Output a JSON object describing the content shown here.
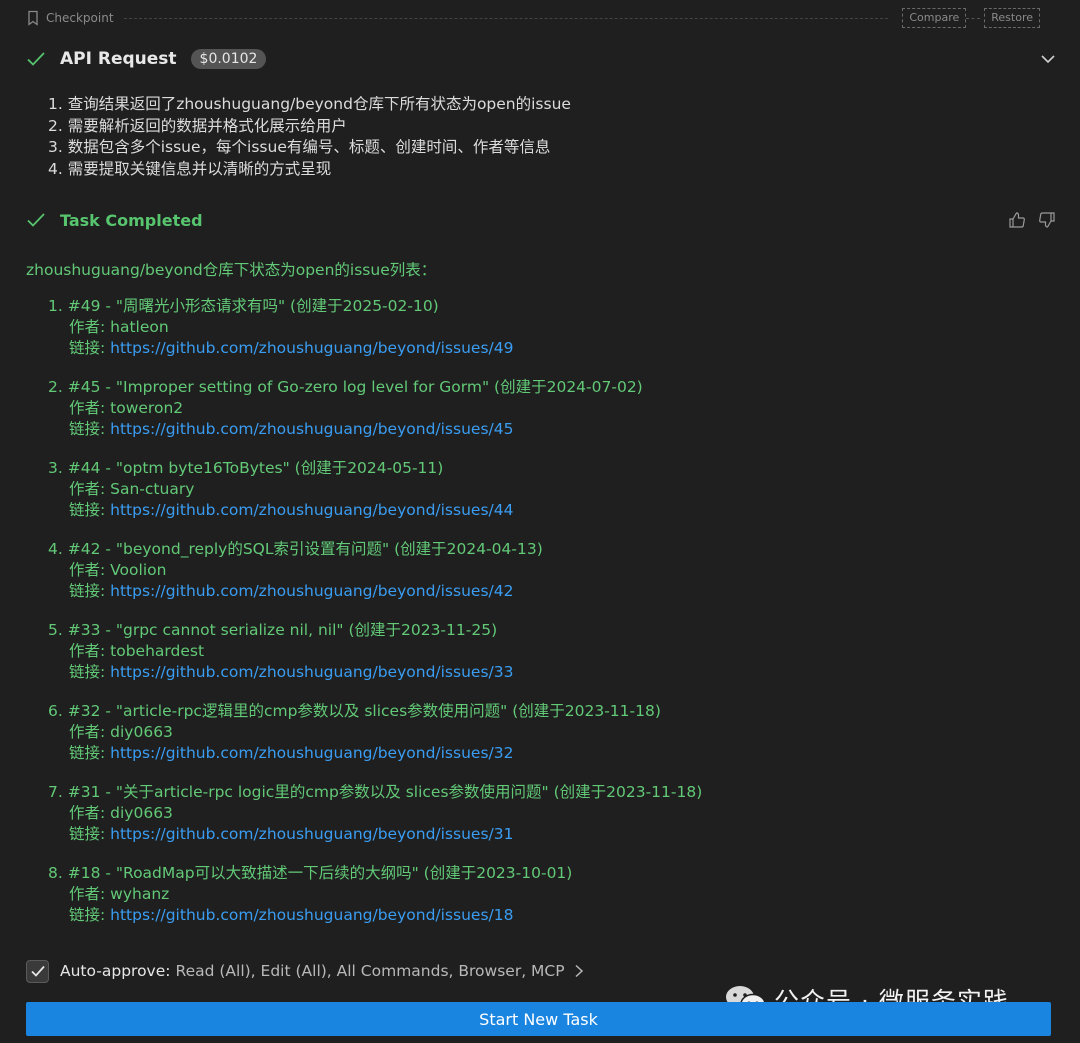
{
  "checkpoint": {
    "label": "Checkpoint",
    "compare": "Compare",
    "restore": "Restore"
  },
  "api_request": {
    "title": "API Request",
    "cost": "$0.0102",
    "items": [
      "1. 查询结果返回了zhoushuguang/beyond仓库下所有状态为open的issue",
      "2. 需要解析返回的数据并格式化展示给用户",
      "3. 数据包含多个issue，每个issue有编号、标题、创建时间、作者等信息",
      "4. 需要提取关键信息并以清晰的方式呈现"
    ]
  },
  "task": {
    "title": "Task Completed",
    "intro": "zhoushuguang/beyond仓库下状态为open的issue列表：",
    "issues": [
      {
        "header": "1. #49 - \"周曙光小形态请求有吗\" (创建于2025-02-10)",
        "author": "作者: hatleon",
        "link_label": "链接: ",
        "link": "https://github.com/zhoushuguang/beyond/issues/49"
      },
      {
        "header": "2. #45 - \"Improper setting of Go-zero log level for Gorm\" (创建于2024-07-02)",
        "author": "作者: toweron2",
        "link_label": "链接: ",
        "link": "https://github.com/zhoushuguang/beyond/issues/45"
      },
      {
        "header": "3. #44 - \"optm byte16ToBytes\" (创建于2024-05-11)",
        "author": "作者: San-ctuary",
        "link_label": "链接: ",
        "link": "https://github.com/zhoushuguang/beyond/issues/44"
      },
      {
        "header": "4. #42 - \"beyond_reply的SQL索引设置有问题\" (创建于2024-04-13)",
        "author": "作者: Voolion",
        "link_label": "链接: ",
        "link": "https://github.com/zhoushuguang/beyond/issues/42"
      },
      {
        "header": "5. #33 - \"grpc cannot serialize nil, nil\" (创建于2023-11-25)",
        "author": "作者: tobehardest",
        "link_label": "链接: ",
        "link": "https://github.com/zhoushuguang/beyond/issues/33"
      },
      {
        "header": "6. #32 - \"article-rpc逻辑里的cmp参数以及 slices参数使用问题\" (创建于2023-11-18)",
        "author": "作者: diy0663",
        "link_label": "链接: ",
        "link": "https://github.com/zhoushuguang/beyond/issues/32"
      },
      {
        "header": "7. #31 - \"关于article-rpc logic里的cmp参数以及 slices参数使用问题\" (创建于2023-11-18)",
        "author": "作者: diy0663",
        "link_label": "链接: ",
        "link": "https://github.com/zhoushuguang/beyond/issues/31"
      },
      {
        "header": "8. #18 - \"RoadMap可以大致描述一下后续的大纲吗\" (创建于2023-10-01)",
        "author": "作者: wyhanz",
        "link_label": "链接: ",
        "link": "https://github.com/zhoushuguang/beyond/issues/18"
      }
    ]
  },
  "auto_approve": {
    "label": "Auto-approve:",
    "value": "Read (All), Edit (All), All Commands, Browser, MCP",
    "checked": true
  },
  "start_button": "Start New Task",
  "watermark": "公众号 · 微服务实践",
  "colors": {
    "accent": "#1a85e0",
    "success": "#57c46e",
    "link": "#3a9df2"
  }
}
